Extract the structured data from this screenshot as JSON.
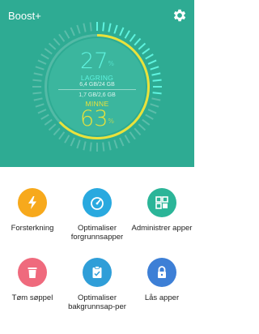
{
  "header": {
    "title": "Boost+",
    "settings_icon": "gear-icon"
  },
  "gauge": {
    "storage": {
      "percent": "27",
      "unit": "%",
      "label": "LAGRING",
      "amount": "6,4 GB/24 GB",
      "color": "#5ff3df"
    },
    "memory": {
      "percent": "63",
      "unit": "%",
      "label": "MINNE",
      "amount": "1,7 GB/2,6 GB",
      "color": "#e9e23b"
    }
  },
  "actions": [
    {
      "label": "Forsterkning",
      "icon": "lightning-icon",
      "color": "#f7a91c"
    },
    {
      "label": "Optimaliser forgrunnsapper",
      "icon": "speedometer-icon",
      "color": "#29a9df"
    },
    {
      "label": "Administrer apper",
      "icon": "apps-grid-icon",
      "color": "#2bb598"
    },
    {
      "label": "Tøm søppel",
      "icon": "trash-icon",
      "color": "#ef6a7d"
    },
    {
      "label": "Optimaliser bakgrunnsap-per",
      "icon": "clipboard-icon",
      "color": "#2f9ed8"
    },
    {
      "label": "Lås apper",
      "icon": "lock-icon",
      "color": "#3d7fd6"
    }
  ]
}
